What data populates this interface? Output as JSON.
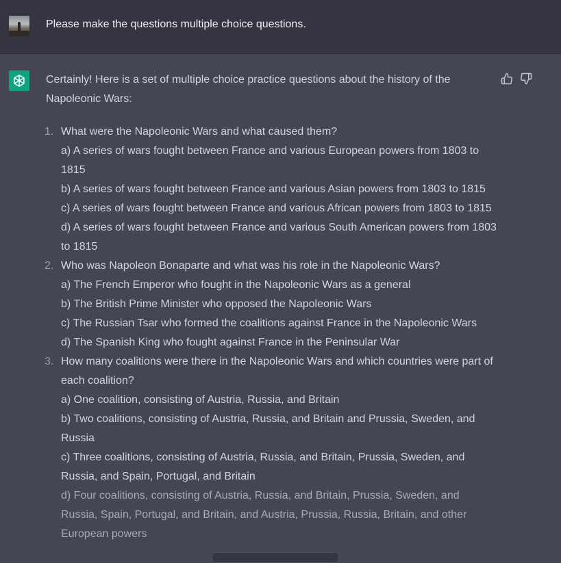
{
  "user_message": {
    "text": "Please make the questions multiple choice questions."
  },
  "assistant_message": {
    "intro": "Certainly! Here is a set of multiple choice practice questions about the history of the Napoleonic Wars:",
    "questions": [
      {
        "number": "1.",
        "text": "What were the Napoleonic Wars and what caused them?",
        "options": [
          "a) A series of wars fought between France and various European powers from 1803 to 1815",
          "b) A series of wars fought between France and various Asian powers from 1803 to 1815",
          "c) A series of wars fought between France and various African powers from 1803 to 1815",
          "d) A series of wars fought between France and various South American powers from 1803 to 1815"
        ]
      },
      {
        "number": "2.",
        "text": "Who was Napoleon Bonaparte and what was his role in the Napoleonic Wars?",
        "options": [
          "a) The French Emperor who fought in the Napoleonic Wars as a general",
          "b) The British Prime Minister who opposed the Napoleonic Wars",
          "c) The Russian Tsar who formed the coalitions against France in the Napoleonic Wars",
          "d) The Spanish King who fought against France in the Peninsular War"
        ]
      },
      {
        "number": "3.",
        "text": "How many coalitions were there in the Napoleonic Wars and which countries were part of each coalition?",
        "options": [
          "a) One coalition, consisting of Austria, Russia, and Britain",
          "b) Two coalitions, consisting of Austria, Russia, and Britain and Prussia, Sweden, and Russia",
          "c) Three coalitions, consisting of Austria, Russia, and Britain, Prussia, Sweden, and Russia, and Spain, Portugal, and Britain",
          "d) Four coalitions, consisting of Austria, Russia, and Britain, Prussia, Sweden, and Russia, Spain, Portugal, and Britain, and Austria, Prussia, Russia, Britain, and other European powers"
        ]
      }
    ]
  },
  "icons": {
    "assistant_avatar": "openai-logo-icon",
    "thumbs_up": "thumbs-up-icon",
    "thumbs_down": "thumbs-down-icon"
  },
  "colors": {
    "user_bg": "#343541",
    "assistant_bg": "#444654",
    "bot_avatar": "#10a37f",
    "text": "#d1d5db"
  }
}
